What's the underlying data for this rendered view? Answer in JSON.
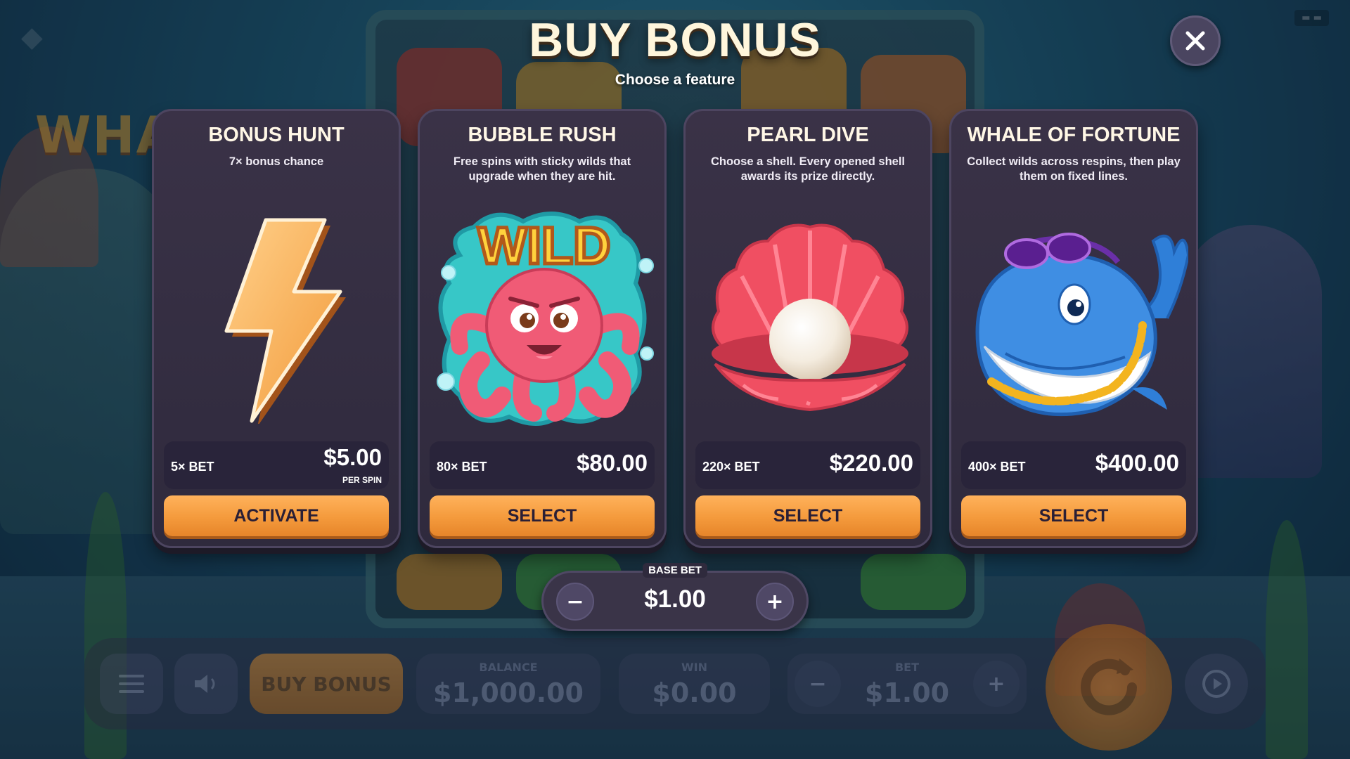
{
  "modal": {
    "title": "BUY BONUS",
    "subtitle": "Choose a feature",
    "close_icon": "close-icon"
  },
  "cards": [
    {
      "title": "BONUS HUNT",
      "description": "7× bonus chance",
      "art": "lightning-bolt-icon",
      "multiplier": "5× BET",
      "price": "$5.00",
      "price_note": "PER SPIN",
      "button": "ACTIVATE"
    },
    {
      "title": "BUBBLE RUSH",
      "description": "Free spins with sticky wilds that upgrade when they are hit.",
      "art": "octopus-wild-icon",
      "art_text": "WILD",
      "multiplier": "80× BET",
      "price": "$80.00",
      "button": "SELECT"
    },
    {
      "title": "PEARL DIVE",
      "description": "Choose a shell. Every opened shell awards its prize directly.",
      "art": "pearl-shell-icon",
      "multiplier": "220× BET",
      "price": "$220.00",
      "button": "SELECT"
    },
    {
      "title": "WHALE OF FORTUNE",
      "description": "Collect wilds across respins, then play them on fixed lines.",
      "art": "whale-sunglasses-icon",
      "multiplier": "400× BET",
      "price": "$400.00",
      "button": "SELECT"
    }
  ],
  "base_bet": {
    "label": "BASE BET",
    "value": "$1.00",
    "minus": "−",
    "plus": "+"
  },
  "background": {
    "game_title": "WHA",
    "bottom_bar": {
      "buy_bonus": "BUY BONUS",
      "balance_label": "BALANCE",
      "balance_value": "$1,000.00",
      "win_label": "WIN",
      "win_value": "$0.00",
      "bet_label": "BET",
      "bet_value": "$1.00",
      "minus": "−",
      "plus": "+"
    }
  },
  "colors": {
    "accent": "#f49a3c",
    "card_bg": "#2f2a3d",
    "title_text": "#fff6dc"
  }
}
